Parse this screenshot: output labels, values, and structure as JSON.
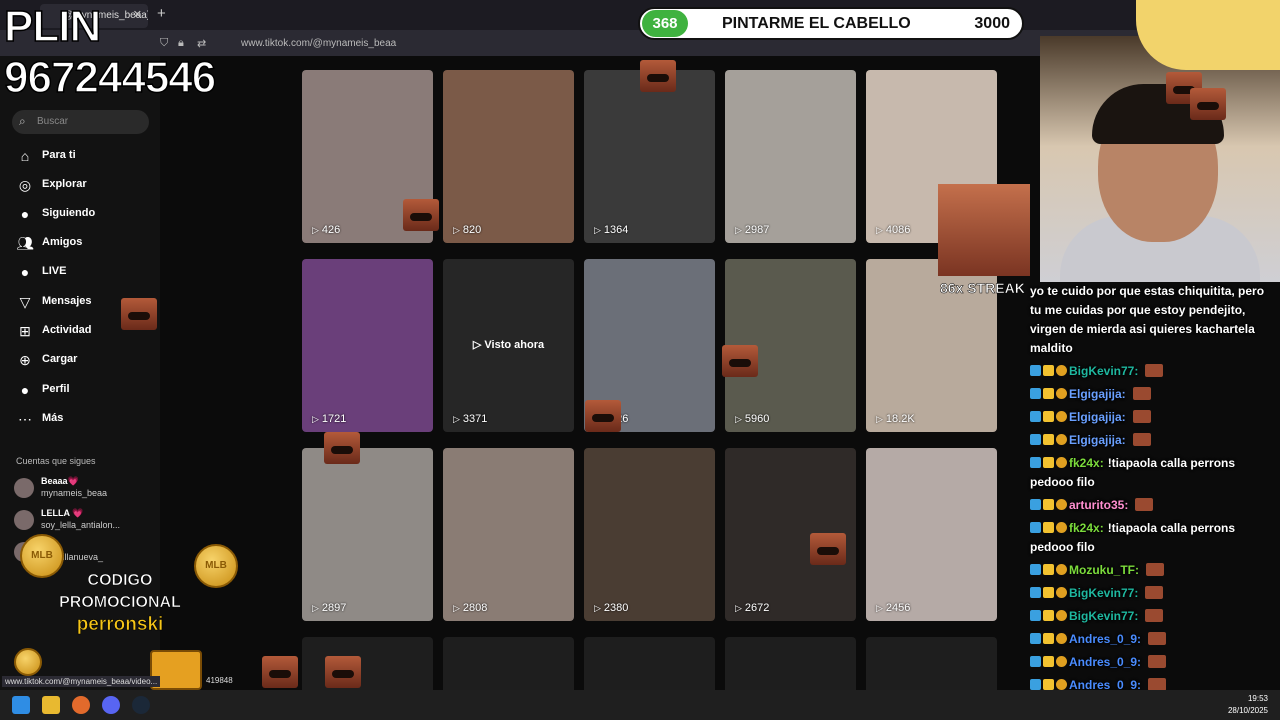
{
  "browser": {
    "tab_title": "(@mynameis_beaa) | ...",
    "url": "www.tiktok.com/@mynameis_beaa",
    "status_url": "www.tiktok.com/@mynameis_beaa/video...",
    "status_num": "419848"
  },
  "overlay": {
    "plin_label": "PLIN",
    "phone": "967244546",
    "promo_line1": "CODIGO",
    "promo_line2": "PROMOCIONAL",
    "promo_code": "perronski",
    "streak": "86x STREAK"
  },
  "goal": {
    "count": "368",
    "title": "PINTARME EL CABELLO",
    "target": "3000"
  },
  "sidebar": {
    "search_placeholder": "Buscar",
    "items": [
      {
        "label": "Para ti",
        "icon": "home-icon"
      },
      {
        "label": "Explorar",
        "icon": "compass-icon"
      },
      {
        "label": "Siguiendo",
        "icon": "following-icon"
      },
      {
        "label": "Amigos",
        "icon": "friends-icon"
      },
      {
        "label": "LIVE",
        "icon": "live-icon"
      },
      {
        "label": "Mensajes",
        "icon": "messages-icon"
      },
      {
        "label": "Actividad",
        "icon": "activity-icon"
      },
      {
        "label": "Cargar",
        "icon": "upload-icon"
      },
      {
        "label": "Perfil",
        "icon": "profile-icon"
      },
      {
        "label": "Más",
        "icon": "more-icon"
      }
    ],
    "following_title": "Cuentas que sigues",
    "accounts": [
      {
        "name": "Beaaa💗",
        "handle": "mynameis_beaa"
      },
      {
        "name": "LELLA 💗",
        "handle": "soy_lella_antialon..."
      },
      {
        "name": "...os",
        "handle": "...osvillanueva_"
      }
    ]
  },
  "videos": [
    {
      "views": "426",
      "bg": "#8a7b78"
    },
    {
      "views": "820",
      "bg": "#7b5a48"
    },
    {
      "views": "1364",
      "bg": "#3a3a3a"
    },
    {
      "views": "2987",
      "bg": "#a5a09a"
    },
    {
      "views": "4086",
      "bg": "#c7b9ad"
    },
    {
      "views": "1721",
      "bg": "#6a3f7a"
    },
    {
      "views": "3371",
      "bg": "#262626",
      "center": "Visto ahora"
    },
    {
      "views": "3326",
      "bg": "#6b6f78"
    },
    {
      "views": "5960",
      "bg": "#5a5a4e"
    },
    {
      "views": "18.2K",
      "bg": "#b8aa9c"
    },
    {
      "views": "2897",
      "bg": "#8f8a86"
    },
    {
      "views": "2808",
      "bg": "#8a7c74"
    },
    {
      "views": "2380",
      "bg": "#4a3d33"
    },
    {
      "views": "2672",
      "bg": "#2f2a28"
    },
    {
      "views": "2456",
      "bg": "#b5aaa6"
    }
  ],
  "chat": [
    {
      "text": "yo te cuido por que estas chiquitita, pero tu me cuidas por que estoy pendejito, virgen de mierda asi quieres kachartela maldito",
      "color": "#ffffff"
    },
    {
      "user": "BigKevin77:",
      "color": "#1fb8a0",
      "text": ""
    },
    {
      "user": "Elgigajija:",
      "color": "#6aa0ff",
      "text": ""
    },
    {
      "user": "Elgigajija:",
      "color": "#6aa0ff",
      "text": ""
    },
    {
      "user": "Elgigajija:",
      "color": "#6aa0ff",
      "text": ""
    },
    {
      "user": "fk24x:",
      "color": "#7cdc3c",
      "text": "!tiapaola calla perrons pedooo filo"
    },
    {
      "user": "arturito35:",
      "color": "#ff8fd0",
      "text": ""
    },
    {
      "user": "fk24x:",
      "color": "#7cdc3c",
      "text": "!tiapaola calla perrons pedooo filo"
    },
    {
      "user": "Mozuku_TF:",
      "color": "#7cdc3c",
      "text": ""
    },
    {
      "user": "BigKevin77:",
      "color": "#1fb8a0",
      "text": ""
    },
    {
      "user": "BigKevin77:",
      "color": "#1fb8a0",
      "text": ""
    },
    {
      "user": "Andres_0_9:",
      "color": "#4a8cff",
      "text": ""
    },
    {
      "user": "Andres_0_9:",
      "color": "#4a8cff",
      "text": ""
    },
    {
      "user": "Andres_0_9:",
      "color": "#4a8cff",
      "text": ""
    },
    {
      "user": "Andres_0_9:",
      "color": "#4a8cff",
      "text": ""
    }
  ],
  "taskbar": {
    "time": "19:53",
    "date": "28/10/2025"
  }
}
